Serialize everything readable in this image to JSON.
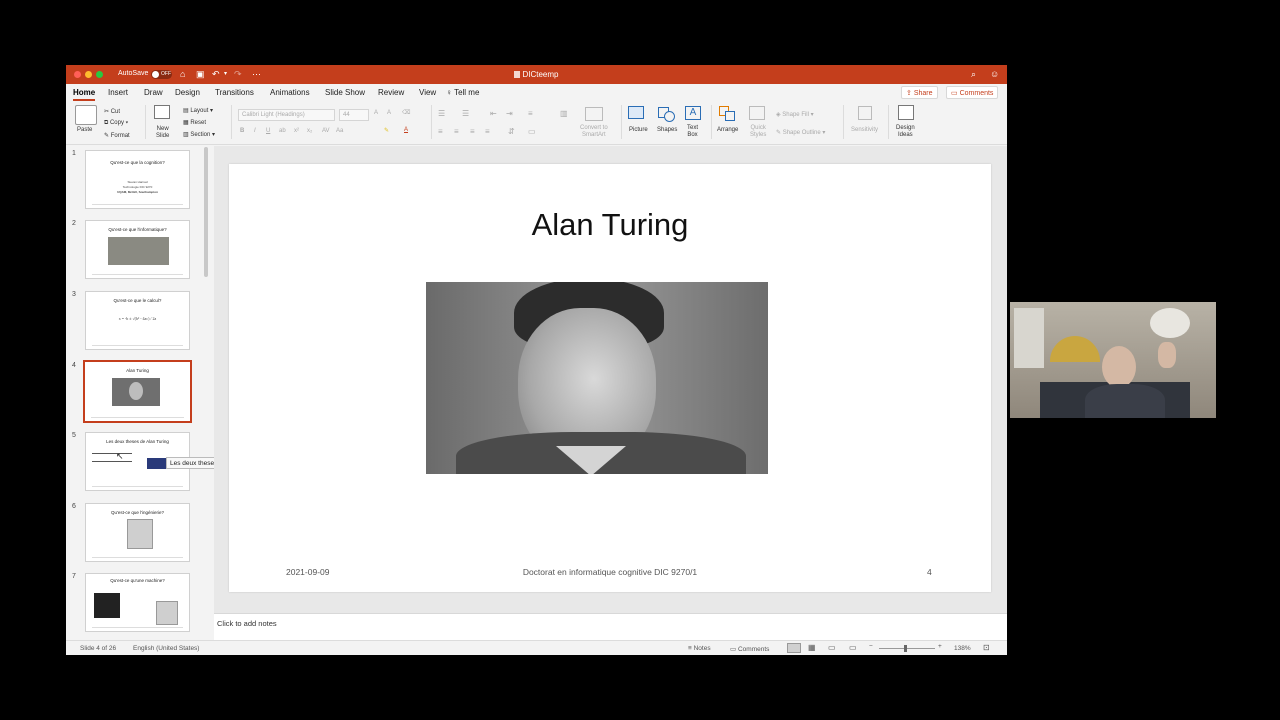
{
  "window": {
    "title": "DICteemp",
    "autosave_label": "AutoSave",
    "autosave_state": "OFF"
  },
  "menu": {
    "tabs": [
      "Home",
      "Insert",
      "Draw",
      "Design",
      "Transitions",
      "Animations",
      "Slide Show",
      "Review",
      "View",
      "Tell me"
    ],
    "share": "Share",
    "comments": "Comments"
  },
  "ribbon": {
    "paste": "Paste",
    "cut": "Cut",
    "copy": "Copy",
    "format": "Format",
    "new_slide": "New\nSlide",
    "layout": "Layout",
    "reset": "Reset",
    "section": "Section",
    "font_name": "Calibri Light (Headings)",
    "font_size": "44",
    "convert_smartart": "Convert to\nSmartArt",
    "picture": "Picture",
    "shapes": "Shapes",
    "text_box": "Text\nBox",
    "arrange": "Arrange",
    "quick_styles": "Quick\nStyles",
    "shape_fill": "Shape Fill",
    "shape_outline": "Shape Outline",
    "sensitivity": "Sensitivity",
    "design_ideas": "Design\nIdeas"
  },
  "thumbnails": [
    {
      "num": "1",
      "title": "Qu'est-ce que la cognition?",
      "lines": [
        "Stevan Harnad",
        "Technologie DIC 9270",
        "UQAM, McGill, Southampton"
      ]
    },
    {
      "num": "2",
      "title": "Qu'est-ce que l'informatique?"
    },
    {
      "num": "3",
      "title": "Qu'est-ce que le calcul?",
      "formula": "x = -b ± √(b² - 4ac) / 2a"
    },
    {
      "num": "4",
      "title": "Alan Turing"
    },
    {
      "num": "5",
      "title": "Les deux theses de Alan Turing"
    },
    {
      "num": "6",
      "title": "Qu'est-ce que l'ingénierie?"
    },
    {
      "num": "7",
      "title": "Qu'est-ce qu'une machine?"
    }
  ],
  "tooltip": "Les deux theses de Alan Turing",
  "slide": {
    "title": "Alan Turing",
    "footer_date": "2021-09-09",
    "footer_center": "Doctorat en informatique cognitive DIC 9270/1",
    "footer_num": "4"
  },
  "notes_placeholder": "Click to add notes",
  "status": {
    "slide_info": "Slide 4 of 26",
    "language": "English (United States)",
    "notes": "Notes",
    "comments": "Comments",
    "zoom": "138%"
  },
  "colors": {
    "accent": "#c43e1c",
    "background": "#000000"
  }
}
